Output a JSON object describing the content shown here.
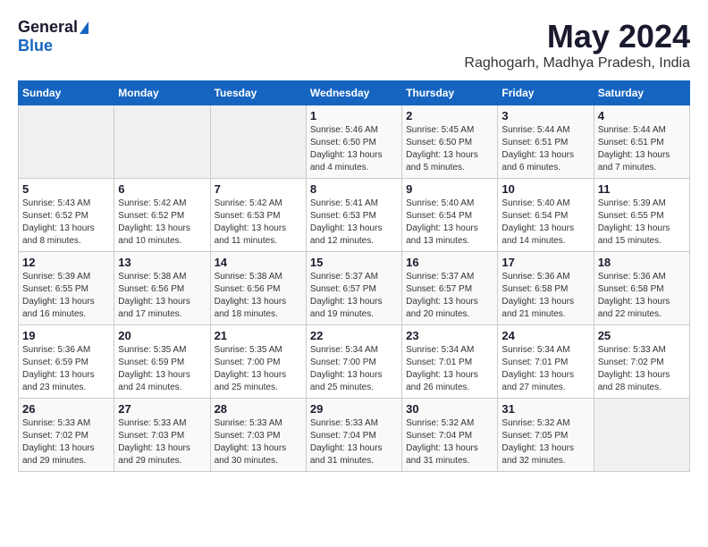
{
  "logo": {
    "general": "General",
    "blue": "Blue"
  },
  "title": "May 2024",
  "location": "Raghogarh, Madhya Pradesh, India",
  "headers": [
    "Sunday",
    "Monday",
    "Tuesday",
    "Wednesday",
    "Thursday",
    "Friday",
    "Saturday"
  ],
  "weeks": [
    [
      {
        "day": "",
        "sunrise": "",
        "sunset": "",
        "daylight": ""
      },
      {
        "day": "",
        "sunrise": "",
        "sunset": "",
        "daylight": ""
      },
      {
        "day": "",
        "sunrise": "",
        "sunset": "",
        "daylight": ""
      },
      {
        "day": "1",
        "sunrise": "Sunrise: 5:46 AM",
        "sunset": "Sunset: 6:50 PM",
        "daylight": "Daylight: 13 hours and 4 minutes."
      },
      {
        "day": "2",
        "sunrise": "Sunrise: 5:45 AM",
        "sunset": "Sunset: 6:50 PM",
        "daylight": "Daylight: 13 hours and 5 minutes."
      },
      {
        "day": "3",
        "sunrise": "Sunrise: 5:44 AM",
        "sunset": "Sunset: 6:51 PM",
        "daylight": "Daylight: 13 hours and 6 minutes."
      },
      {
        "day": "4",
        "sunrise": "Sunrise: 5:44 AM",
        "sunset": "Sunset: 6:51 PM",
        "daylight": "Daylight: 13 hours and 7 minutes."
      }
    ],
    [
      {
        "day": "5",
        "sunrise": "Sunrise: 5:43 AM",
        "sunset": "Sunset: 6:52 PM",
        "daylight": "Daylight: 13 hours and 8 minutes."
      },
      {
        "day": "6",
        "sunrise": "Sunrise: 5:42 AM",
        "sunset": "Sunset: 6:52 PM",
        "daylight": "Daylight: 13 hours and 10 minutes."
      },
      {
        "day": "7",
        "sunrise": "Sunrise: 5:42 AM",
        "sunset": "Sunset: 6:53 PM",
        "daylight": "Daylight: 13 hours and 11 minutes."
      },
      {
        "day": "8",
        "sunrise": "Sunrise: 5:41 AM",
        "sunset": "Sunset: 6:53 PM",
        "daylight": "Daylight: 13 hours and 12 minutes."
      },
      {
        "day": "9",
        "sunrise": "Sunrise: 5:40 AM",
        "sunset": "Sunset: 6:54 PM",
        "daylight": "Daylight: 13 hours and 13 minutes."
      },
      {
        "day": "10",
        "sunrise": "Sunrise: 5:40 AM",
        "sunset": "Sunset: 6:54 PM",
        "daylight": "Daylight: 13 hours and 14 minutes."
      },
      {
        "day": "11",
        "sunrise": "Sunrise: 5:39 AM",
        "sunset": "Sunset: 6:55 PM",
        "daylight": "Daylight: 13 hours and 15 minutes."
      }
    ],
    [
      {
        "day": "12",
        "sunrise": "Sunrise: 5:39 AM",
        "sunset": "Sunset: 6:55 PM",
        "daylight": "Daylight: 13 hours and 16 minutes."
      },
      {
        "day": "13",
        "sunrise": "Sunrise: 5:38 AM",
        "sunset": "Sunset: 6:56 PM",
        "daylight": "Daylight: 13 hours and 17 minutes."
      },
      {
        "day": "14",
        "sunrise": "Sunrise: 5:38 AM",
        "sunset": "Sunset: 6:56 PM",
        "daylight": "Daylight: 13 hours and 18 minutes."
      },
      {
        "day": "15",
        "sunrise": "Sunrise: 5:37 AM",
        "sunset": "Sunset: 6:57 PM",
        "daylight": "Daylight: 13 hours and 19 minutes."
      },
      {
        "day": "16",
        "sunrise": "Sunrise: 5:37 AM",
        "sunset": "Sunset: 6:57 PM",
        "daylight": "Daylight: 13 hours and 20 minutes."
      },
      {
        "day": "17",
        "sunrise": "Sunrise: 5:36 AM",
        "sunset": "Sunset: 6:58 PM",
        "daylight": "Daylight: 13 hours and 21 minutes."
      },
      {
        "day": "18",
        "sunrise": "Sunrise: 5:36 AM",
        "sunset": "Sunset: 6:58 PM",
        "daylight": "Daylight: 13 hours and 22 minutes."
      }
    ],
    [
      {
        "day": "19",
        "sunrise": "Sunrise: 5:36 AM",
        "sunset": "Sunset: 6:59 PM",
        "daylight": "Daylight: 13 hours and 23 minutes."
      },
      {
        "day": "20",
        "sunrise": "Sunrise: 5:35 AM",
        "sunset": "Sunset: 6:59 PM",
        "daylight": "Daylight: 13 hours and 24 minutes."
      },
      {
        "day": "21",
        "sunrise": "Sunrise: 5:35 AM",
        "sunset": "Sunset: 7:00 PM",
        "daylight": "Daylight: 13 hours and 25 minutes."
      },
      {
        "day": "22",
        "sunrise": "Sunrise: 5:34 AM",
        "sunset": "Sunset: 7:00 PM",
        "daylight": "Daylight: 13 hours and 25 minutes."
      },
      {
        "day": "23",
        "sunrise": "Sunrise: 5:34 AM",
        "sunset": "Sunset: 7:01 PM",
        "daylight": "Daylight: 13 hours and 26 minutes."
      },
      {
        "day": "24",
        "sunrise": "Sunrise: 5:34 AM",
        "sunset": "Sunset: 7:01 PM",
        "daylight": "Daylight: 13 hours and 27 minutes."
      },
      {
        "day": "25",
        "sunrise": "Sunrise: 5:33 AM",
        "sunset": "Sunset: 7:02 PM",
        "daylight": "Daylight: 13 hours and 28 minutes."
      }
    ],
    [
      {
        "day": "26",
        "sunrise": "Sunrise: 5:33 AM",
        "sunset": "Sunset: 7:02 PM",
        "daylight": "Daylight: 13 hours and 29 minutes."
      },
      {
        "day": "27",
        "sunrise": "Sunrise: 5:33 AM",
        "sunset": "Sunset: 7:03 PM",
        "daylight": "Daylight: 13 hours and 29 minutes."
      },
      {
        "day": "28",
        "sunrise": "Sunrise: 5:33 AM",
        "sunset": "Sunset: 7:03 PM",
        "daylight": "Daylight: 13 hours and 30 minutes."
      },
      {
        "day": "29",
        "sunrise": "Sunrise: 5:33 AM",
        "sunset": "Sunset: 7:04 PM",
        "daylight": "Daylight: 13 hours and 31 minutes."
      },
      {
        "day": "30",
        "sunrise": "Sunrise: 5:32 AM",
        "sunset": "Sunset: 7:04 PM",
        "daylight": "Daylight: 13 hours and 31 minutes."
      },
      {
        "day": "31",
        "sunrise": "Sunrise: 5:32 AM",
        "sunset": "Sunset: 7:05 PM",
        "daylight": "Daylight: 13 hours and 32 minutes."
      },
      {
        "day": "",
        "sunrise": "",
        "sunset": "",
        "daylight": ""
      }
    ]
  ]
}
